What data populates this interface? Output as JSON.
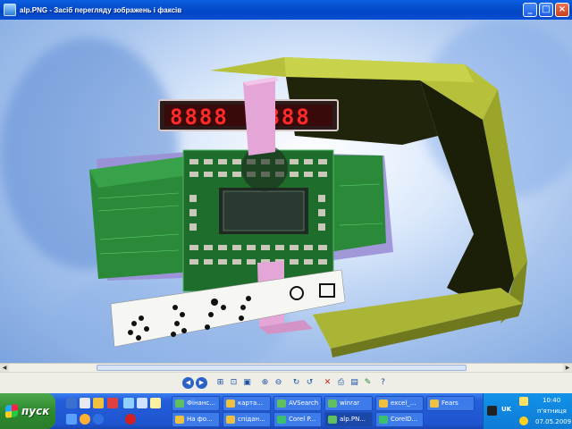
{
  "window": {
    "title": "alp.PNG - Засіб перегляду зображень і факсів",
    "buttons": {
      "minimize": "_",
      "maximize": "□",
      "close": "×"
    }
  },
  "display": {
    "digits_left": "8888",
    "digits_right": "8888"
  },
  "toolbar": {
    "icons": [
      "prev-image-icon",
      "next-image-icon",
      "best-fit-icon",
      "actual-size-icon",
      "slideshow-icon",
      "zoom-in-icon",
      "zoom-out-icon",
      "rotate-cw-icon",
      "rotate-ccw-icon",
      "delete-icon",
      "print-icon",
      "save-icon",
      "edit-icon",
      "help-icon"
    ]
  },
  "taskbar": {
    "start_label": "пуск",
    "tasks_row1": [
      "Фінанс...",
      "карта...",
      "AVSearch",
      "winrar",
      "excel_...",
      "Fears"
    ],
    "tasks_row2": [
      "На фо...",
      "спідан...",
      "Corel P...",
      "alp.PN...",
      "CorelD..."
    ],
    "tray": {
      "lang": "UK",
      "time": "10:40",
      "day": "п'ятниця",
      "date": "07.05.2009"
    }
  },
  "colors": {
    "taskbar": "#245edb",
    "start": "#2e8a2e",
    "pcb": "#2a8a3a",
    "frame": "#9aa52a",
    "led": "#ff2a2a"
  }
}
